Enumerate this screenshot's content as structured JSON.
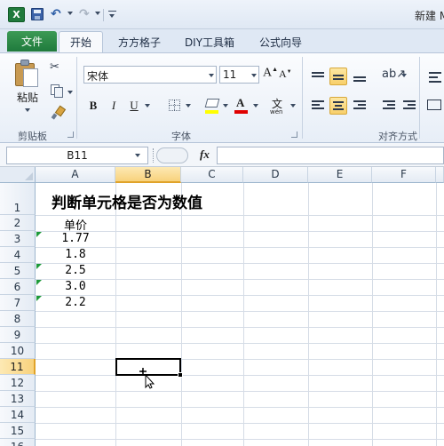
{
  "titlebar": {
    "window_title": "新建 M",
    "app_icon": "excel-logo-icon",
    "app_icon_letter": "X"
  },
  "tabs": {
    "file": "文件",
    "items": [
      "开始",
      "方方格子",
      "DIY工具箱",
      "公式向导"
    ],
    "active": "开始"
  },
  "ribbon": {
    "clipboard": {
      "label": "剪贴板",
      "paste": "粘贴"
    },
    "font": {
      "label": "字体",
      "name": "宋体",
      "size": "11",
      "wen": "wén",
      "wen_char": "文"
    },
    "alignment": {
      "label": "对齐方式"
    }
  },
  "formula_bar": {
    "name_box": "B11",
    "fx": "fx",
    "formula": ""
  },
  "sheet": {
    "columns": [
      "A",
      "B",
      "C",
      "D",
      "E",
      "F"
    ],
    "rows": [
      "1",
      "2",
      "3",
      "4",
      "5",
      "6",
      "7",
      "8",
      "9",
      "10",
      "11",
      "12",
      "13",
      "14",
      "15",
      "16"
    ],
    "selected_column": "B",
    "selected_row": "11",
    "title": "判断单元格是否为数值",
    "header": "单价",
    "values": [
      "1.77",
      "1.8",
      "2.5",
      "3.0",
      "2.2"
    ]
  },
  "colors": {
    "file_tab": "#1f7a3c",
    "selection_highlight": "#f8d27c",
    "text_number_marker": "#1e9a3a",
    "font_color": "#e00000",
    "fill_color": "#ffff00"
  }
}
